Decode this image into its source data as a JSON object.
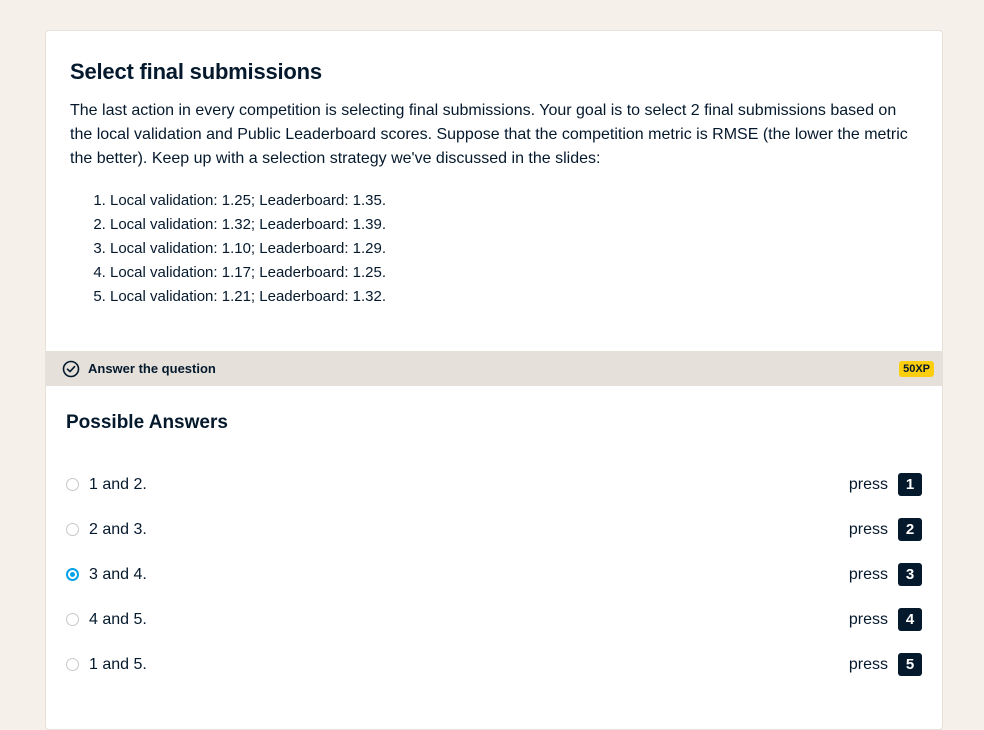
{
  "exercise": {
    "title": "Select final submissions",
    "description": "The last action in every competition is selecting final submissions. Your goal is to select 2 final submissions based on the local validation and Public Leaderboard scores. Suppose that the competition metric is RMSE (the lower the metric the better). Keep up with a selection strategy we've discussed in the slides:",
    "items": [
      "Local validation: 1.25; Leaderboard: 1.35.",
      "Local validation: 1.32; Leaderboard: 1.39.",
      "Local validation: 1.10; Leaderboard: 1.29.",
      "Local validation: 1.17; Leaderboard: 1.25.",
      "Local validation: 1.21; Leaderboard: 1.32."
    ]
  },
  "answer_bar": {
    "label": "Answer the question",
    "xp": "50XP",
    "icon": "check-circle-icon"
  },
  "answers": {
    "title": "Possible Answers",
    "press_label": "press",
    "selected_index": 2,
    "options": [
      {
        "label": "1 and 2.",
        "key": "1"
      },
      {
        "label": "2 and 3.",
        "key": "2"
      },
      {
        "label": "3 and 4.",
        "key": "3"
      },
      {
        "label": "4 and 5.",
        "key": "4"
      },
      {
        "label": "1 and 5.",
        "key": "5"
      }
    ]
  },
  "colors": {
    "accent": "#03a1e7",
    "xp_badge": "#fcce0d",
    "text": "#05192d",
    "bar": "#e5e1da",
    "page_bg": "#f5f1ea"
  }
}
